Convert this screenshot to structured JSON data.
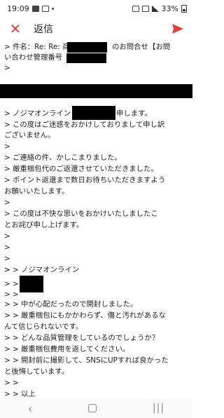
{
  "status": {
    "time": "19:09",
    "battery": "33%"
  },
  "app_bar": {
    "close_icon": "✕",
    "title": "返信",
    "send_icon": "send-icon"
  },
  "body": {
    "lines": [
      "> 件名：Re: Re: 商",
      "のお問合せ【お問",
      "い合わせ管理番号",
      ">",
      "> ノジマオンライン",
      "申します。",
      "> この度はご迷惑をおかけしておりまして申し訳",
      "ございません。",
      ">",
      "> ご連絡の件、かしこまりました。",
      "> 厳重梱包代のご返還させていただきました。",
      "> ポイント返還まで数日お待ちいただきますよう",
      "お願いいたします。",
      ">",
      "> この度は不快な思いをおかけいたしましたこ",
      "とお詫び申し上げます。",
      ">",
      ">",
      ">",
      ">",
      "> > ノジマオンライン",
      "> >",
      "> >",
      "> > 中が心配だったので開封しました。",
      "> > 厳重梱包にもかかわらず、傷と汚れがあるな",
      "んて信じられないです。",
      "> > どんな品質管理をしているのでしょうか？",
      "> > 厳重梱包費用を返してください。",
      "> > 開封前に撮影して、SNSにUPすれば良かった",
      "と後悔しています。",
      "> >",
      "> > 以上",
      ">"
    ]
  }
}
